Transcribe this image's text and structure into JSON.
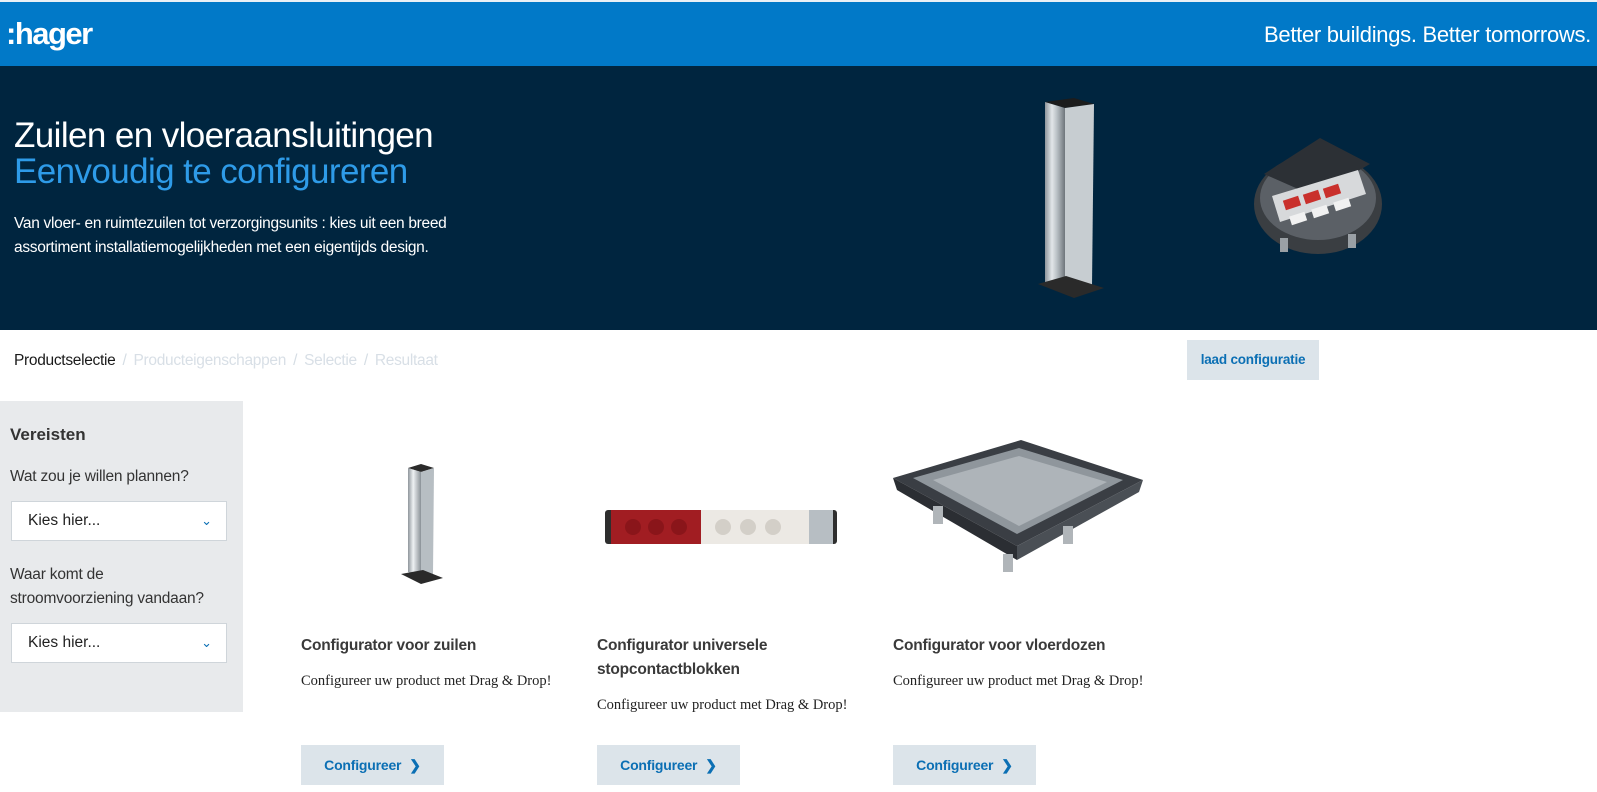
{
  "header": {
    "logo": ":hager",
    "tagline": "Better buildings. Better tomorrows."
  },
  "hero": {
    "title": "Zuilen en vloeraansluitingen",
    "subtitle": "Eenvoudig te configureren",
    "text": "Van vloer- en ruimtezuilen tot verzorgingsunits : kies uit een breed assortiment installatiemogelijkheden met een eigentijds design."
  },
  "breadcrumb": {
    "steps": [
      "Productselectie",
      "Producteigenschappen",
      "Selectie",
      "Resultaat"
    ],
    "separator": "/"
  },
  "load_button": "laad configuratie",
  "sidebar": {
    "title": "Vereisten",
    "q1": "Wat zou je willen plannen?",
    "q1_value": "Kies hier...",
    "q2": "Waar komt de stroomvoorziening vandaan?",
    "q2_value": "Kies hier..."
  },
  "cards": [
    {
      "title": "Configurator voor zuilen",
      "desc": "Configureer uw product met Drag & Drop!",
      "button": "Configureer"
    },
    {
      "title": "Configurator universele stopcontactblokken",
      "desc": "Configureer uw product met Drag & Drop!",
      "button": "Configureer"
    },
    {
      "title": "Configurator voor vloerdozen",
      "desc": "Configureer uw product met Drag & Drop!",
      "button": "Configureer"
    }
  ],
  "colors": {
    "brand_blue": "#0179c8",
    "hero_bg": "#00253f",
    "accent_light_blue": "#2e9be8",
    "button_bg": "#dce4ea",
    "button_text": "#0b6fb4"
  }
}
